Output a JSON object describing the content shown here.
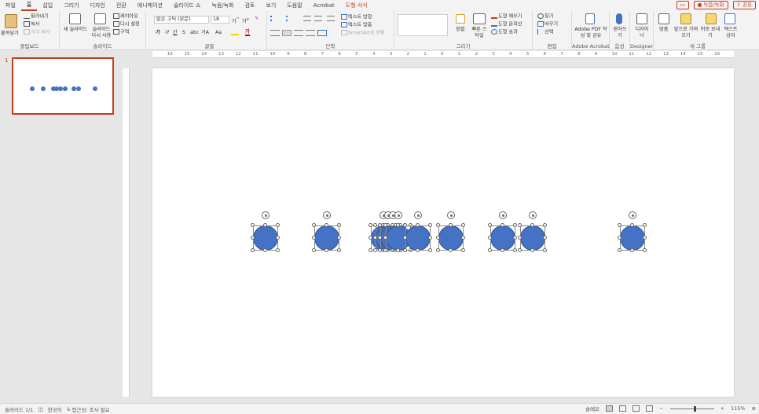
{
  "menu": {
    "tabs": [
      "파일",
      "홈",
      "삽입",
      "그리기",
      "디자인",
      "전환",
      "애니메이션",
      "슬라이드 쇼",
      "녹음/녹화",
      "검토",
      "보기",
      "도움말",
      "Acrobat",
      "도형 서식"
    ],
    "active_tab": "홈",
    "contextual_tab": "도형 서식",
    "record_label": "● 녹음/녹화",
    "share_label": "공유",
    "comment_icon": "comment-icon"
  },
  "ribbon": {
    "clipboard": {
      "label": "클립보드",
      "paste": "붙여넣기",
      "cut": "잘라내기",
      "copy": "복사",
      "format_painter": "서식 복사"
    },
    "slides": {
      "label": "슬라이드",
      "new_slide": "새 슬라이드",
      "reuse_slide": "슬라이드 다시 사용",
      "layout": "레이아웃",
      "reset": "다시 설정",
      "section": "구역"
    },
    "font": {
      "label": "글꼴",
      "font_name": "맑은 고딕 (본문)",
      "font_size": "18",
      "bold": "가",
      "italic": "가",
      "underline": "간",
      "strike": "S",
      "shadow": "abc",
      "spacing": "가A",
      "case": "Aa"
    },
    "paragraph": {
      "label": "단락",
      "text_direction": "텍스트 방향",
      "align_text": "텍스트 맞춤",
      "smartart": "SmartArt로 변환"
    },
    "drawing": {
      "label": "그리기",
      "arrange": "정렬",
      "quick_styles": "빠른 스타일",
      "shape_fill": "도형 채우기",
      "shape_outline": "도형 윤곽선",
      "shape_effects": "도형 효과"
    },
    "editing": {
      "label": "편집",
      "find": "찾기",
      "replace": "바꾸기",
      "select": "선택"
    },
    "adobe": {
      "label": "Adobe Acrobat",
      "create_pdf": "Adobe PDF 작성 및 공유"
    },
    "voice": {
      "label": "음성",
      "dictate": "받아쓰기"
    },
    "designer": {
      "label": "Designer",
      "design_ideas": "디자이너"
    },
    "new_group": {
      "label": "새 그룹",
      "align": "맞춤",
      "bring_forward": "앞으로 가져오기",
      "send_backward": "뒤로 보내기",
      "text_box": "텍스트 상자"
    }
  },
  "ruler": {
    "ticks": [
      "16",
      "15",
      "14",
      "13",
      "12",
      "11",
      "10",
      "9",
      "8",
      "7",
      "6",
      "5",
      "4",
      "3",
      "2",
      "1",
      "0",
      "1",
      "2",
      "3",
      "4",
      "5",
      "6",
      "7",
      "8",
      "9",
      "10",
      "11",
      "12",
      "13",
      "14",
      "15",
      "16"
    ]
  },
  "thumbnails": [
    {
      "number": "1"
    }
  ],
  "statusbar": {
    "slide_indicator": "슬라이드 1/1",
    "language": "한국어",
    "accessibility": "접근성: 조사 필요",
    "notes": "슬메모",
    "zoom": "115%"
  },
  "colors": {
    "accent": "#c43e1c",
    "shape_fill": "#4472c4",
    "shape_outline": "#2f528f"
  }
}
